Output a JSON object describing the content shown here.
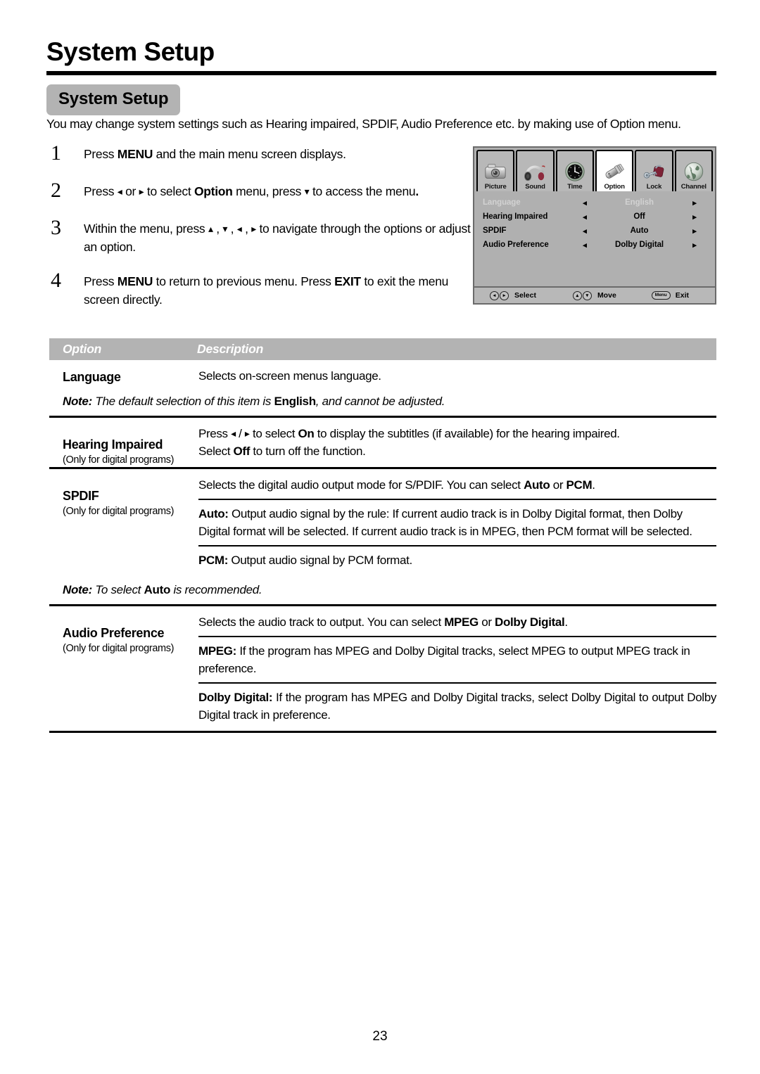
{
  "header": {
    "title": "System Setup",
    "chip_label": "System Setup",
    "intro": "You may change system settings such as Hearing impaired, SPDIF, Audio Preference etc. by making use of Option menu."
  },
  "steps": [
    {
      "number": "1",
      "text_parts": [
        {
          "t": "Press ",
          "b": false
        },
        {
          "t": "MENU",
          "b": true
        },
        {
          "t": " and the main menu screen displays.",
          "b": false
        }
      ]
    },
    {
      "number": "2",
      "text_parts": [
        {
          "t": "Press ",
          "b": false
        },
        {
          "t": "◂",
          "b": false
        },
        {
          "t": " or ",
          "b": false
        },
        {
          "t": "▸",
          "b": false
        },
        {
          "t": " to select ",
          "b": false
        },
        {
          "t": "Option",
          "b": true
        },
        {
          "t": " menu,  press ",
          "b": false
        },
        {
          "t": "▾",
          "b": false
        },
        {
          "t": " to access the menu",
          "b": false
        },
        {
          "t": ".",
          "b": true
        }
      ]
    },
    {
      "number": "3",
      "text_parts": [
        {
          "t": "Within the menu, press ",
          "b": false
        },
        {
          "t": "▴",
          "b": false
        },
        {
          "t": " , ",
          "b": false
        },
        {
          "t": "▾",
          "b": false
        },
        {
          "t": " , ",
          "b": false
        },
        {
          "t": "◂",
          "b": false
        },
        {
          "t": " , ",
          "b": false
        },
        {
          "t": "▸",
          "b": false
        },
        {
          "t": " to navigate through the options or adjust an option.",
          "b": false
        }
      ]
    },
    {
      "number": "4",
      "text_parts": [
        {
          "t": "Press ",
          "b": false
        },
        {
          "t": "MENU",
          "b": true
        },
        {
          "t": " to return to previous menu. Press ",
          "b": false
        },
        {
          "t": "EXIT",
          "b": true
        },
        {
          "t": " to exit the menu screen directly.",
          "b": false
        }
      ]
    }
  ],
  "osd": {
    "tabs": [
      {
        "label": "Picture",
        "icon": "camera-icon",
        "active": false
      },
      {
        "label": "Sound",
        "icon": "headphones-icon",
        "active": false
      },
      {
        "label": "Time",
        "icon": "clock-icon",
        "active": false
      },
      {
        "label": "Option",
        "icon": "plug-connector-icon",
        "active": true
      },
      {
        "label": "Lock",
        "icon": "padlock-key-icon",
        "active": false
      },
      {
        "label": "Channel",
        "icon": "globe-icon",
        "active": false
      }
    ],
    "rows": [
      {
        "label": "Language",
        "value": "English",
        "left_arrow": "◂",
        "right_arrow": "▸",
        "disabled": true
      },
      {
        "label": "Hearing Impaired",
        "value": "Off",
        "left_arrow": "◂",
        "right_arrow": "▸",
        "disabled": false
      },
      {
        "label": "SPDIF",
        "value": "Auto",
        "left_arrow": "◂",
        "right_arrow": "▸",
        "disabled": false
      },
      {
        "label": "Audio Preference",
        "value": "Dolby Digital",
        "left_arrow": "◂",
        "right_arrow": "▸",
        "disabled": false
      }
    ],
    "footer": {
      "select_keys": "◂▸",
      "select_label": "Select",
      "move_keys": "▴▾",
      "move_label": "Move",
      "exit_key": "Menu",
      "exit_label": "Exit"
    },
    "colors": {
      "panel_bg": "#b0b0b0",
      "tab_bg": "#b8b8b8",
      "tab_active_bg": "#ffffff",
      "border": "#6b6b6b",
      "disabled_text": "#d2d2d2"
    }
  },
  "table": {
    "headers": {
      "option": "Option",
      "description": "Description"
    },
    "header_bg": "#b3b3b3",
    "rows": [
      {
        "option_title": "Language",
        "option_sub": "",
        "blocks": [
          {
            "parts": [
              {
                "t": "Selects on-screen menus language.",
                "b": false
              }
            ]
          }
        ]
      },
      {
        "option_title": "Hearing Impaired",
        "option_sub": "(Only for digital programs)",
        "blocks": [
          {
            "parts": [
              {
                "t": "Press ",
                "b": false
              },
              {
                "t": "◂",
                "b": false
              },
              {
                "t": " / ",
                "b": false
              },
              {
                "t": "▸",
                "b": false
              },
              {
                "t": " to select ",
                "b": false
              },
              {
                "t": "On",
                "b": true
              },
              {
                "t": " to display the subtitles (if available) for the hearing impaired.",
                "b": false
              }
            ]
          },
          {
            "parts": [
              {
                "t": "Select ",
                "b": false
              },
              {
                "t": "Off",
                "b": true
              },
              {
                "t": " to turn off the function.",
                "b": false
              }
            ]
          }
        ]
      },
      {
        "option_title": "SPDIF",
        "option_sub": "(Only for digital programs)",
        "blocks": [
          {
            "parts": [
              {
                "t": "Selects the digital audio output mode for S/PDIF. You can select ",
                "b": false
              },
              {
                "t": "Auto",
                "b": true
              },
              {
                "t": " or ",
                "b": false
              },
              {
                "t": "PCM",
                "b": true
              },
              {
                "t": ".",
                "b": false
              }
            ]
          },
          {
            "rule_before": true,
            "parts": [
              {
                "t": "Auto:",
                "b": true
              },
              {
                "t": " Output audio signal by the rule: If current audio track is in Dolby Digital format, then Dolby Digital format will be selected. If current audio track is in MPEG, then PCM format will be selected.",
                "b": false
              }
            ]
          },
          {
            "rule_before": true,
            "parts": [
              {
                "t": "PCM:",
                "b": true
              },
              {
                "t": " Output audio signal by PCM format.",
                "b": false
              }
            ]
          }
        ]
      },
      {
        "option_title": "Audio Preference",
        "option_sub": "(Only for digital programs)",
        "blocks": [
          {
            "parts": [
              {
                "t": "Selects the audio track to output. You can select ",
                "b": false
              },
              {
                "t": "MPEG",
                "b": true
              },
              {
                "t": " or ",
                "b": false
              },
              {
                "t": "Dolby Digital",
                "b": true
              },
              {
                "t": ".",
                "b": false
              }
            ]
          },
          {
            "rule_before": true,
            "parts": [
              {
                "t": "MPEG:",
                "b": true
              },
              {
                "t": " If the program has MPEG and Dolby Digital tracks, select MPEG to output MPEG track in preference.",
                "b": false
              }
            ]
          },
          {
            "rule_before": true,
            "justify": true,
            "parts": [
              {
                "t": "Dolby Digital:",
                "b": true
              },
              {
                "t": " If the program has MPEG and Dolby Digital tracks, select Dolby Digital to output Dolby Digital track in preference.",
                "b": false
              }
            ]
          }
        ]
      }
    ],
    "notes": [
      {
        "after_row": 0,
        "parts": [
          {
            "t": "Note:",
            "b": true,
            "i": true
          },
          {
            "t": " The default selection of this item is ",
            "b": false,
            "i": true
          },
          {
            "t": "English",
            "b": true,
            "i": false
          },
          {
            "t": ", and cannot be adjusted.",
            "b": false,
            "i": true
          }
        ]
      },
      {
        "after_row": 2,
        "parts": [
          {
            "t": "Note:",
            "b": true,
            "i": true
          },
          {
            "t": " To select ",
            "b": false,
            "i": true
          },
          {
            "t": "Auto",
            "b": true,
            "i": false
          },
          {
            "t": " is recommended.",
            "b": false,
            "i": true
          }
        ]
      }
    ]
  },
  "footer": {
    "page_number": "23"
  }
}
